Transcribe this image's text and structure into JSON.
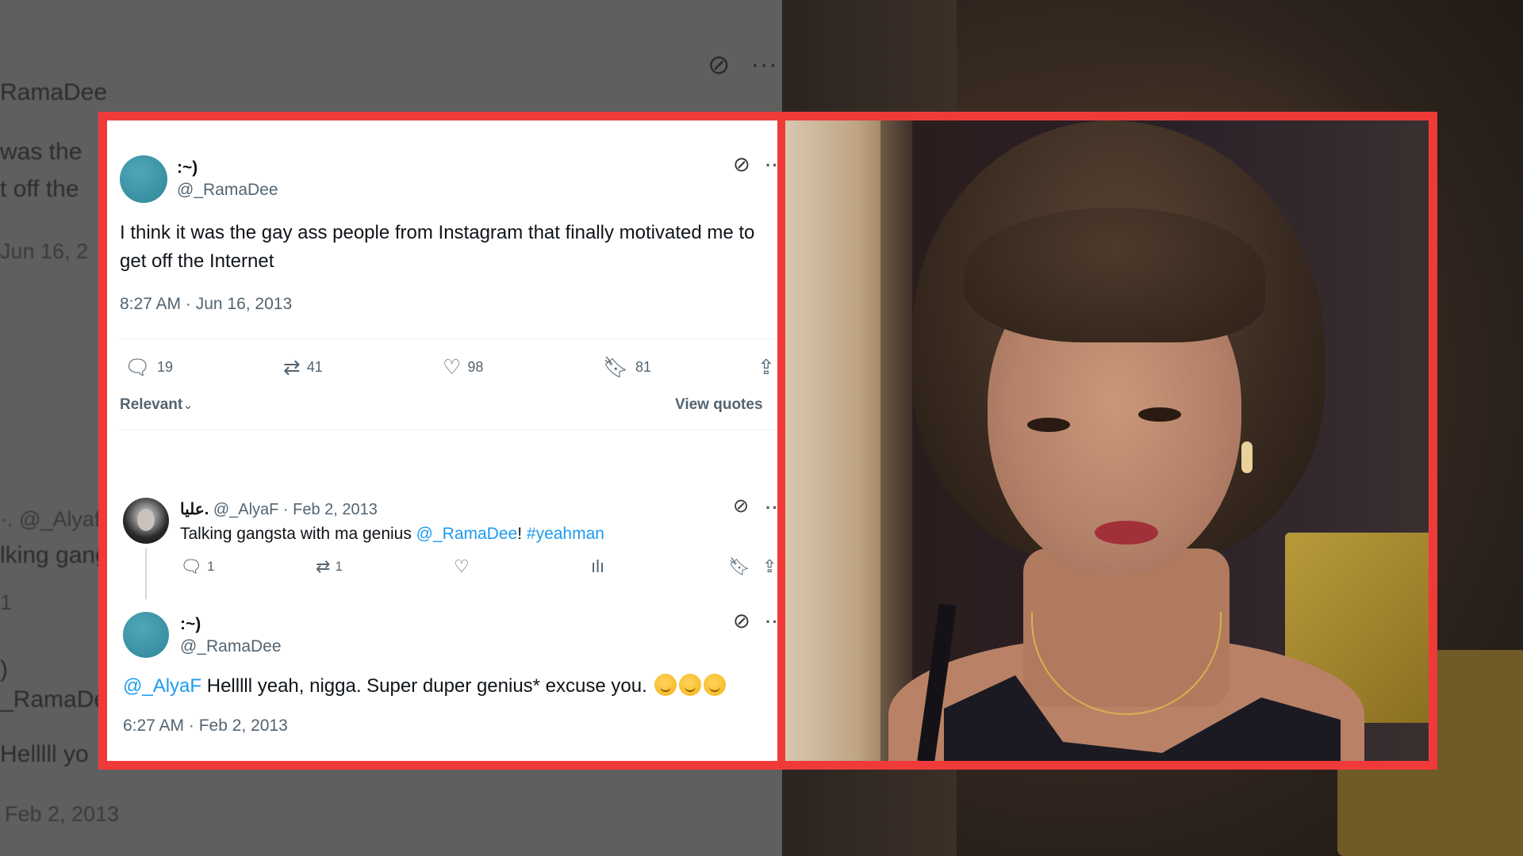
{
  "background": {
    "left_fragments": [
      "RamaDee",
      "was the",
      "t off the",
      "Jun 16, 2",
      "·. @_Alyaf",
      "lking gang",
      "1",
      ")",
      "_RamaDee",
      "Helllll yo",
      "Feb 2, 2013"
    ]
  },
  "main_tweet": {
    "name": ":~)",
    "handle": "@_RamaDee",
    "text": "I think it was the gay ass people from Instagram that finally motivated me to get off the Internet",
    "timestamp": "8:27 AM · Jun 16, 2013",
    "replies": "19",
    "retweets": "41",
    "likes": "98",
    "bookmarks": "81",
    "sort_label": "Relevant",
    "view_quotes": "View quotes"
  },
  "reply_tweet": {
    "name": "عليا.",
    "handle": "@_AlyaF",
    "date": "Feb 2, 2013",
    "text_prefix": "Talking gangsta with ma genius ",
    "mention": "@_RamaDee",
    "text_mid": "! ",
    "hashtag": "#yeahman",
    "replies": "1",
    "retweets": "1"
  },
  "response_tweet": {
    "name": ":~)",
    "handle": "@_RamaDee",
    "mention": "@_AlyaF",
    "text": " Helllll yeah, nigga. Super duper genius* excuse you. ",
    "timestamp": "6:27 AM · Feb 2, 2013"
  },
  "colors": {
    "frame": "#f03a3a",
    "link": "#1d9bf0",
    "secondary_text": "#536471",
    "avatar": "#3a94a6"
  },
  "icons": [
    "sync-off-icon",
    "more-dots-icon",
    "reply-icon",
    "retweet-icon",
    "like-icon",
    "bookmark-icon",
    "share-icon",
    "analytics-icon",
    "chevron-down-icon",
    "smirk-emoji-icon"
  ]
}
